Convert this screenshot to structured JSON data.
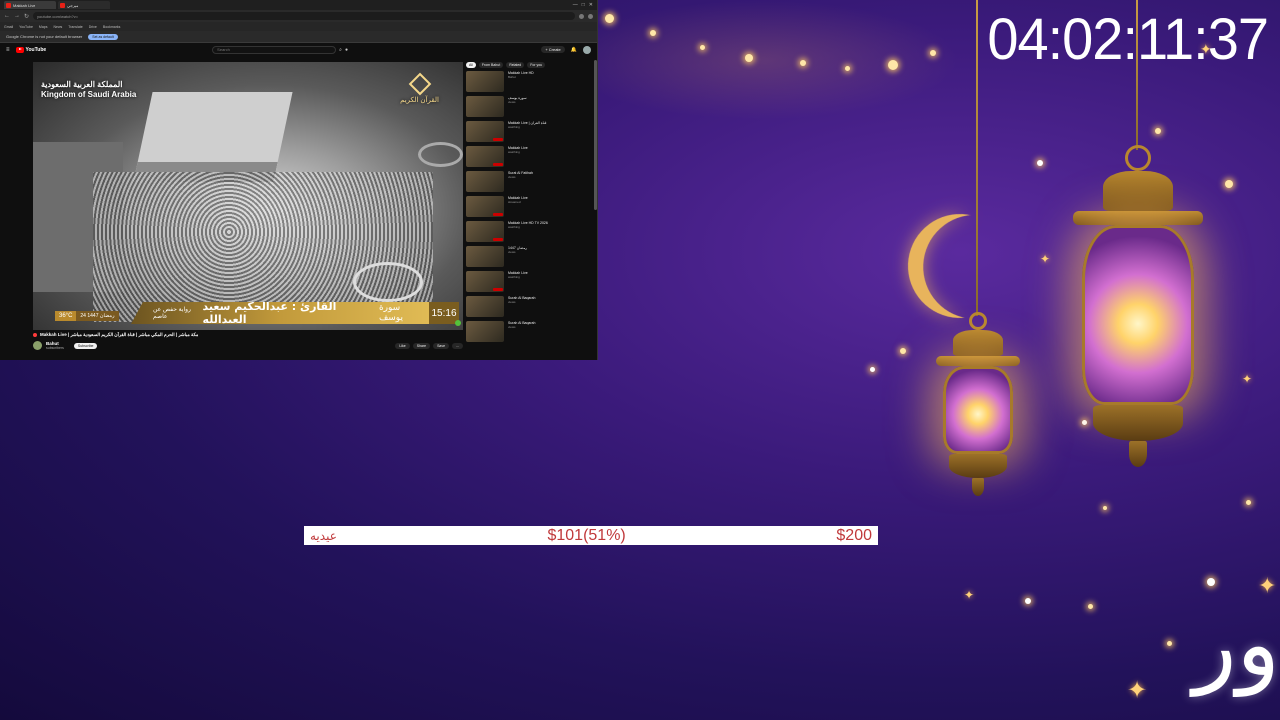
{
  "timer": "04:02:11:37",
  "colors": {
    "background": "#2a1568",
    "goal_text": "#c0393b",
    "goal_bar": "#ffffff",
    "lantern_glow": "#ffd36a",
    "youtube_red": "#ff0000"
  },
  "browser": {
    "tabs": [
      {
        "label": "Makkah Live",
        "active": true
      },
      {
        "label": "ميرجي",
        "active": false
      }
    ],
    "url": "youtube.com/watch?v=",
    "infobar": {
      "text": "Google Chrome is not your default browser",
      "button": "Set as default"
    },
    "bookmarks": [
      "Gmail",
      "YouTube",
      "Maps",
      "News",
      "Translate",
      "Drive",
      "Bookmarks"
    ]
  },
  "youtube": {
    "search_placeholder": "Search",
    "create_label": "+ Create",
    "player": {
      "country_ar": "المملكة العربية السعودية",
      "country_en": "Kingdom of Saudi Arabia",
      "channel_mark": "القرآن الكريم",
      "temperature": "36°C",
      "date": "24 رمضان 1447",
      "sub_caption": "رواية حفص عن عاصم",
      "reader": "القارئ : عبدالحكيم سعيد العبدالله",
      "surah": "سورة يوسف",
      "clock": "15:16"
    },
    "video_title": "Makkah Live | مكة مباشر | الحرم المكي مباشر | قناة القرآن الكريم السعودية مباشر",
    "channel_name": "Bahut",
    "channel_subs": "subscribers",
    "subscribe_label": "Subscribe",
    "actions": [
      "Like",
      "Share",
      "Save",
      "..."
    ],
    "chips": [
      {
        "label": "All",
        "active": true
      },
      {
        "label": "From Bahut",
        "active": false
      },
      {
        "label": "Related",
        "active": false
      },
      {
        "label": "For you",
        "active": false
      }
    ],
    "recommendations": [
      {
        "title": "Makkah Live HD",
        "meta": "Bahut",
        "live": false
      },
      {
        "title": "سورة يوسف",
        "meta": "views",
        "live": false
      },
      {
        "title": "Makkah Live | قناة القرآن",
        "meta": "watching",
        "live": true
      },
      {
        "title": "Makkah Live",
        "meta": "watching",
        "live": true
      },
      {
        "title": "Surat Al Fatihah",
        "meta": "views",
        "live": false
      },
      {
        "title": "Makkah Live",
        "meta": "streamed",
        "live": true
      },
      {
        "title": "Makkah Live HD TV 2026",
        "meta": "watching",
        "live": true
      },
      {
        "title": "1447 رمضان",
        "meta": "views",
        "live": false
      },
      {
        "title": "Makkah Live",
        "meta": "watching",
        "live": true
      },
      {
        "title": "Surah Al Baqarah",
        "meta": "views",
        "live": false
      },
      {
        "title": "Surah Al Baqarah",
        "meta": "views",
        "live": false
      }
    ]
  },
  "donation_goal": {
    "label": "عيديه",
    "current": "$101(51%)",
    "target": "$200",
    "progress_fraction": 0.51
  },
  "corner_logo": "ور"
}
